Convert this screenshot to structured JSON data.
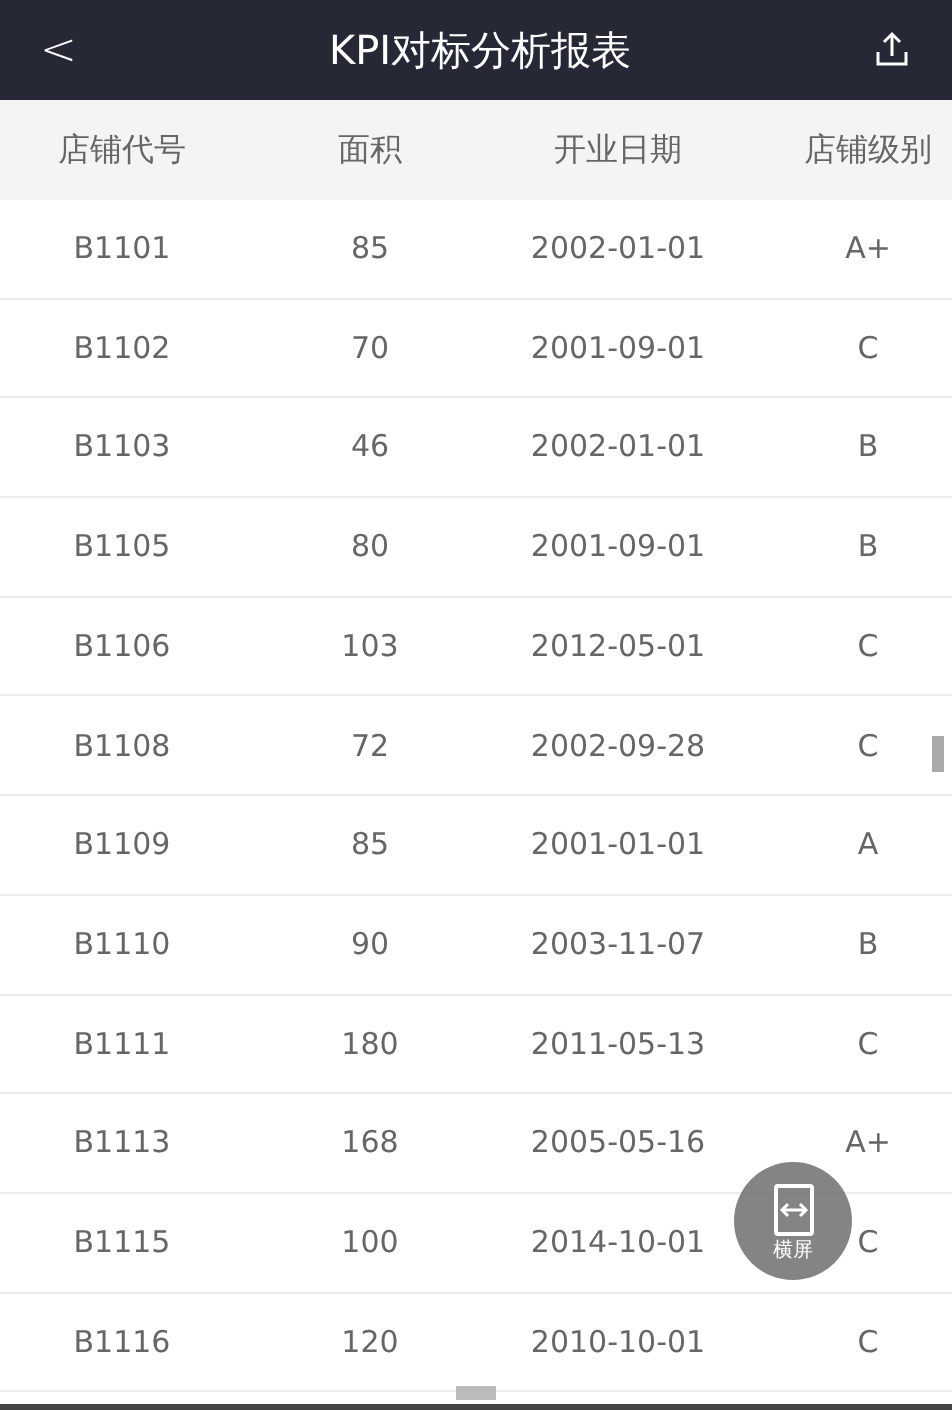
{
  "header": {
    "back": "<",
    "title": "KPI对标分析报表"
  },
  "table": {
    "columns": [
      "店铺代号",
      "面积",
      "开业日期",
      "店铺级别"
    ],
    "rows": [
      [
        "B1101",
        "85",
        "2002-01-01",
        "A+"
      ],
      [
        "B1102",
        "70",
        "2001-09-01",
        "C"
      ],
      [
        "B1103",
        "46",
        "2002-01-01",
        "B"
      ],
      [
        "B1105",
        "80",
        "2001-09-01",
        "B"
      ],
      [
        "B1106",
        "103",
        "2012-05-01",
        "C"
      ],
      [
        "B1108",
        "72",
        "2002-09-28",
        "C"
      ],
      [
        "B1109",
        "85",
        "2001-01-01",
        "A"
      ],
      [
        "B1110",
        "90",
        "2003-11-07",
        "B"
      ],
      [
        "B1111",
        "180",
        "2011-05-13",
        "C"
      ],
      [
        "B1113",
        "168",
        "2005-05-16",
        "A+"
      ],
      [
        "B1115",
        "100",
        "2014-10-01",
        "C"
      ],
      [
        "B1116",
        "120",
        "2010-10-01",
        "C"
      ]
    ]
  },
  "rotate_button": {
    "label": "横屏"
  }
}
